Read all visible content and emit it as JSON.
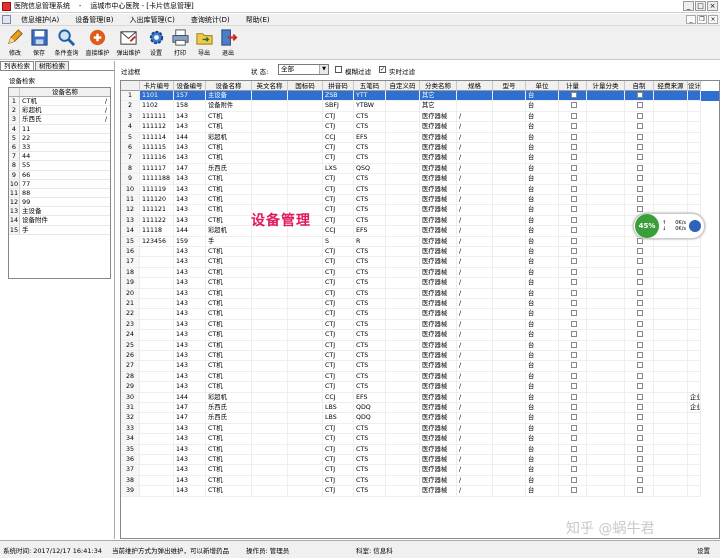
{
  "window": {
    "title": "医院信息管理系统    -    运城市中心医院 - [卡片信息管理]"
  },
  "menu": {
    "items": [
      "信息维护(A)",
      "设备管理(B)",
      "入出库管理(C)",
      "查询统计(D)",
      "帮助(E)"
    ]
  },
  "toolbar": {
    "items": [
      {
        "label": "修改",
        "icon": "edit-icon"
      },
      {
        "label": "保存",
        "icon": "save-icon"
      },
      {
        "label": "条件查询",
        "icon": "search-icon"
      },
      {
        "label": "直接维护",
        "icon": "maintain-icon"
      },
      {
        "label": "弹出维护",
        "icon": "popup-maintain-icon"
      },
      {
        "label": "设置",
        "icon": "gear-icon"
      },
      {
        "label": "打印",
        "icon": "printer-icon"
      },
      {
        "label": "导出",
        "icon": "export-icon"
      },
      {
        "label": "退出",
        "icon": "exit-icon"
      }
    ]
  },
  "left": {
    "tabs": [
      "列表检索",
      "树形检索"
    ],
    "search_label": "设备检索",
    "grid_header": "设备名称",
    "rows": [
      {
        "idx": "1",
        "name": "CT机",
        "mark": "/"
      },
      {
        "idx": "2",
        "name": "彩超机",
        "mark": "/"
      },
      {
        "idx": "3",
        "name": "乐西氏",
        "mark": "/"
      },
      {
        "idx": "4",
        "name": "11",
        "mark": ""
      },
      {
        "idx": "5",
        "name": "22",
        "mark": ""
      },
      {
        "idx": "6",
        "name": "33",
        "mark": ""
      },
      {
        "idx": "7",
        "name": "44",
        "mark": ""
      },
      {
        "idx": "8",
        "name": "55",
        "mark": ""
      },
      {
        "idx": "9",
        "name": "66",
        "mark": ""
      },
      {
        "idx": "10",
        "name": "77",
        "mark": ""
      },
      {
        "idx": "11",
        "name": "88",
        "mark": ""
      },
      {
        "idx": "12",
        "name": "99",
        "mark": ""
      },
      {
        "idx": "13",
        "name": "主设备",
        "mark": ""
      },
      {
        "idx": "14",
        "name": "设备附件",
        "mark": ""
      },
      {
        "idx": "15",
        "name": "手",
        "mark": ""
      }
    ]
  },
  "filter": {
    "label": "过滤框",
    "status_label": "状 态:",
    "status_value": "全部",
    "fuzzy_label": "模糊过滤",
    "realtime_label": "实时过滤"
  },
  "grid": {
    "columns": [
      "",
      "卡片编号",
      "设备编号",
      "设备名称",
      "英文名称",
      "国标码",
      "拼音码",
      "五笔码",
      "自定义码",
      "分类名称",
      "规格",
      "型号",
      "单位",
      "计量",
      "计量分类",
      "自制",
      "经费来源",
      "设计"
    ],
    "rows": [
      [
        "1",
        "1101",
        "157",
        "主设备",
        "",
        "",
        "ZSB",
        "YTT",
        "",
        "其它",
        "",
        "",
        "台"
      ],
      [
        "2",
        "1102",
        "158",
        "设备附件",
        "",
        "",
        "SBFJ",
        "YTBW",
        "",
        "其它",
        "",
        "",
        "台"
      ],
      [
        "3",
        "111111",
        "143",
        "CT机",
        "",
        "",
        "CTJ",
        "CTS",
        "",
        "医疗器械",
        "/",
        "",
        "台"
      ],
      [
        "4",
        "111112",
        "143",
        "CT机",
        "",
        "",
        "CTJ",
        "CTS",
        "",
        "医疗器械",
        "/",
        "",
        "台"
      ],
      [
        "5",
        "111114",
        "144",
        "彩超机",
        "",
        "",
        "CCJ",
        "EFS",
        "",
        "医疗器械",
        "/",
        "",
        "台"
      ],
      [
        "6",
        "111115",
        "143",
        "CT机",
        "",
        "",
        "CTJ",
        "CTS",
        "",
        "医疗器械",
        "/",
        "",
        "台"
      ],
      [
        "7",
        "111116",
        "143",
        "CT机",
        "",
        "",
        "CTJ",
        "CTS",
        "",
        "医疗器械",
        "/",
        "",
        "台"
      ],
      [
        "8",
        "111117",
        "147",
        "乐西氏",
        "",
        "",
        "LXS",
        "QSQ",
        "",
        "医疗器械",
        "/",
        "",
        "台"
      ],
      [
        "9",
        "1111188",
        "143",
        "CT机",
        "",
        "",
        "CTJ",
        "CTS",
        "",
        "医疗器械",
        "/",
        "",
        "台"
      ],
      [
        "10",
        "111119",
        "143",
        "CT机",
        "",
        "",
        "CTJ",
        "CTS",
        "",
        "医疗器械",
        "/",
        "",
        "台"
      ],
      [
        "11",
        "111120",
        "143",
        "CT机",
        "",
        "",
        "CTJ",
        "CTS",
        "",
        "医疗器械",
        "/",
        "",
        "台"
      ],
      [
        "12",
        "111121",
        "143",
        "CT机",
        "",
        "",
        "CTJ",
        "CTS",
        "",
        "医疗器械",
        "/",
        "",
        "台"
      ],
      [
        "13",
        "111122",
        "143",
        "CT机",
        "",
        "",
        "CTJ",
        "CTS",
        "",
        "医疗器械",
        "/",
        "",
        "台"
      ],
      [
        "14",
        "11118",
        "144",
        "彩超机",
        "",
        "",
        "CCJ",
        "EFS",
        "",
        "医疗器械",
        "/",
        "",
        "台"
      ],
      [
        "15",
        "123456",
        "159",
        "手",
        "",
        "",
        "S",
        "R",
        "",
        "医疗器械",
        "/",
        "",
        "台"
      ],
      [
        "16",
        "",
        "143",
        "CT机",
        "",
        "",
        "CTJ",
        "CTS",
        "",
        "医疗器械",
        "/",
        "",
        "台"
      ],
      [
        "17",
        "",
        "143",
        "CT机",
        "",
        "",
        "CTJ",
        "CTS",
        "",
        "医疗器械",
        "/",
        "",
        "台"
      ],
      [
        "18",
        "",
        "143",
        "CT机",
        "",
        "",
        "CTJ",
        "CTS",
        "",
        "医疗器械",
        "/",
        "",
        "台"
      ],
      [
        "19",
        "",
        "143",
        "CT机",
        "",
        "",
        "CTJ",
        "CTS",
        "",
        "医疗器械",
        "/",
        "",
        "台"
      ],
      [
        "20",
        "",
        "143",
        "CT机",
        "",
        "",
        "CTJ",
        "CTS",
        "",
        "医疗器械",
        "/",
        "",
        "台"
      ],
      [
        "21",
        "",
        "143",
        "CT机",
        "",
        "",
        "CTJ",
        "CTS",
        "",
        "医疗器械",
        "/",
        "",
        "台"
      ],
      [
        "22",
        "",
        "143",
        "CT机",
        "",
        "",
        "CTJ",
        "CTS",
        "",
        "医疗器械",
        "/",
        "",
        "台"
      ],
      [
        "23",
        "",
        "143",
        "CT机",
        "",
        "",
        "CTJ",
        "CTS",
        "",
        "医疗器械",
        "/",
        "",
        "台"
      ],
      [
        "24",
        "",
        "143",
        "CT机",
        "",
        "",
        "CTJ",
        "CTS",
        "",
        "医疗器械",
        "/",
        "",
        "台"
      ],
      [
        "25",
        "",
        "143",
        "CT机",
        "",
        "",
        "CTJ",
        "CTS",
        "",
        "医疗器械",
        "/",
        "",
        "台"
      ],
      [
        "26",
        "",
        "143",
        "CT机",
        "",
        "",
        "CTJ",
        "CTS",
        "",
        "医疗器械",
        "/",
        "",
        "台"
      ],
      [
        "27",
        "",
        "143",
        "CT机",
        "",
        "",
        "CTJ",
        "CTS",
        "",
        "医疗器械",
        "/",
        "",
        "台"
      ],
      [
        "28",
        "",
        "143",
        "CT机",
        "",
        "",
        "CTJ",
        "CTS",
        "",
        "医疗器械",
        "/",
        "",
        "台"
      ],
      [
        "29",
        "",
        "143",
        "CT机",
        "",
        "",
        "CTJ",
        "CTS",
        "",
        "医疗器械",
        "/",
        "",
        "台"
      ],
      [
        "30",
        "",
        "144",
        "彩超机",
        "",
        "",
        "CCJ",
        "EFS",
        "",
        "医疗器械",
        "/",
        "",
        "台"
      ],
      [
        "31",
        "",
        "147",
        "乐西氏",
        "",
        "",
        "LBS",
        "QDQ",
        "",
        "医疗器械",
        "/",
        "",
        "台"
      ],
      [
        "32",
        "",
        "147",
        "乐西氏",
        "",
        "",
        "LBS",
        "QDQ",
        "",
        "医疗器械",
        "/",
        "",
        "台"
      ],
      [
        "33",
        "",
        "143",
        "CT机",
        "",
        "",
        "CTJ",
        "CTS",
        "",
        "医疗器械",
        "/",
        "",
        "台"
      ],
      [
        "34",
        "",
        "143",
        "CT机",
        "",
        "",
        "CTJ",
        "CTS",
        "",
        "医疗器械",
        "/",
        "",
        "台"
      ],
      [
        "35",
        "",
        "143",
        "CT机",
        "",
        "",
        "CTJ",
        "CTS",
        "",
        "医疗器械",
        "/",
        "",
        "台"
      ],
      [
        "36",
        "",
        "143",
        "CT机",
        "",
        "",
        "CTJ",
        "CTS",
        "",
        "医疗器械",
        "/",
        "",
        "台"
      ],
      [
        "37",
        "",
        "143",
        "CT机",
        "",
        "",
        "CTJ",
        "CTS",
        "",
        "医疗器械",
        "/",
        "",
        "台"
      ],
      [
        "38",
        "",
        "143",
        "CT机",
        "",
        "",
        "CTJ",
        "CTS",
        "",
        "医疗器械",
        "/",
        "",
        "台"
      ],
      [
        "39",
        "",
        "143",
        "CT机",
        "",
        "",
        "CTJ",
        "CTS",
        "",
        "医疗器械",
        "/",
        "",
        "台"
      ]
    ],
    "extra": {
      "30": "企业",
      "31": "企业"
    }
  },
  "overlay_text": "设备管理",
  "widget": {
    "percent": "45%",
    "up": "0K/s",
    "down": "0K/s"
  },
  "statusbar": {
    "time": "系统时间: 2017/12/17  16:41:34",
    "hint": "当前维护方式为弹出维护，可以新增药品",
    "operator": "操作员: 管理员",
    "dept": "科室: 信息科",
    "settings": "设置"
  },
  "watermark": "知乎 @蜗牛君",
  "colors": {
    "selection": "#2f6fd0",
    "overlay": "#e0195a",
    "gauge": "#3a9e3a"
  }
}
